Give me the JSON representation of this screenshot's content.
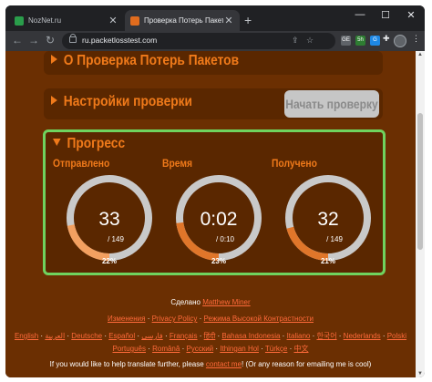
{
  "browser": {
    "tabs": [
      {
        "title": "NozNet.ru",
        "favicon_color": "#2a9d4b"
      },
      {
        "title": "Проверка Потерь Пакетов – Пр",
        "favicon_color": "#e06c1e"
      }
    ],
    "new_tab": "+",
    "url": "ru.packetlosstest.com",
    "extensions": [
      {
        "label": "GE",
        "color": "#5f6368"
      },
      {
        "label": "5h",
        "color": "#2e7d32"
      },
      {
        "label": "G",
        "color": "#1e88e5"
      },
      {
        "label": "",
        "color": "#9aa0a6"
      }
    ]
  },
  "page": {
    "section_about": "О Проверка Потерь Пакетов",
    "section_settings": "Настройки проверки",
    "start_button": "Начать проверку",
    "progress_title": "Прогресс",
    "gauges": [
      {
        "label": "Отправлено",
        "value": "33",
        "sub": "/ 149",
        "percent_text": "22%",
        "fraction": 0.22
      },
      {
        "label": "Время",
        "value": "0:02",
        "sub": "/ 0:10",
        "percent_text": "23%",
        "fraction": 0.23
      },
      {
        "label": "Получено",
        "value": "32",
        "sub": "/ 149",
        "percent_text": "21%",
        "fraction": 0.21
      }
    ],
    "footer": {
      "made_by": "Сделано",
      "author": "Matthew Miner",
      "links": [
        "Изменения",
        "Privacy Policy",
        "Режима Высокой Контрастности"
      ],
      "languages_1": [
        "English",
        "العربية",
        "Deutsche",
        "Español",
        "فارسی",
        "Français",
        "हिंदी",
        "Bahasa Indonesia",
        "Italiano",
        "한국어",
        "Nederlands",
        "Polski"
      ],
      "languages_2": [
        "Português",
        "Română",
        "Русский",
        "Ithingan Hol",
        "Türkçe",
        "中文"
      ],
      "help_prefix": "If you would like to help translate further, please",
      "help_link": "contact me",
      "help_suffix": "! (Or any reason for emailing me is cool)"
    }
  },
  "colors": {
    "accent_orange": "#f07a1a",
    "gauge_fill_1": "#f3a060",
    "gauge_fill_2": "#e0762a",
    "gauge_track": "#c9c9c9",
    "highlight_border": "#6fd35e",
    "page_bg": "#6b2f02"
  }
}
